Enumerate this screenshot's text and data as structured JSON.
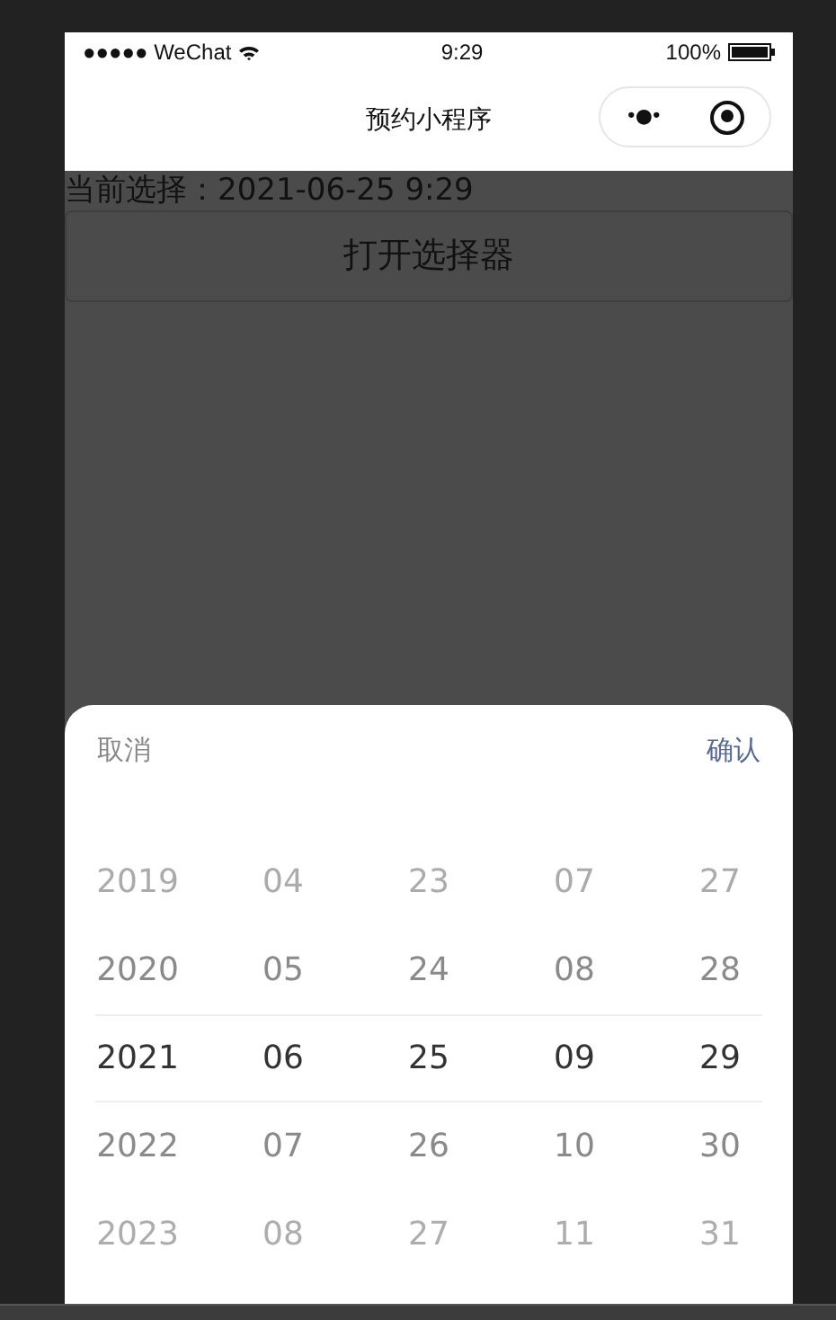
{
  "status_bar": {
    "carrier": "●●●●● WeChat",
    "time": "9:29",
    "battery": "100%"
  },
  "nav_bar": {
    "title": "预约小程序",
    "more": "•●•"
  },
  "current_selection": "当前选择：2021-06-25 9:29",
  "open_button": "打开选择器",
  "picker": {
    "cancel": "取消",
    "confirm": "确认",
    "rows": [
      {
        "cells": [
          "2019",
          "04",
          "23",
          "07",
          "27"
        ],
        "selected": false
      },
      {
        "cells": [
          "2020",
          "05",
          "24",
          "08",
          "28"
        ],
        "selected": false
      },
      {
        "cells": [
          "2021",
          "06",
          "25",
          "09",
          "29"
        ],
        "selected": true
      },
      {
        "cells": [
          "2022",
          "07",
          "26",
          "10",
          "30"
        ],
        "selected": false
      },
      {
        "cells": [
          "2023",
          "08",
          "27",
          "11",
          "31"
        ],
        "selected": false
      }
    ]
  }
}
